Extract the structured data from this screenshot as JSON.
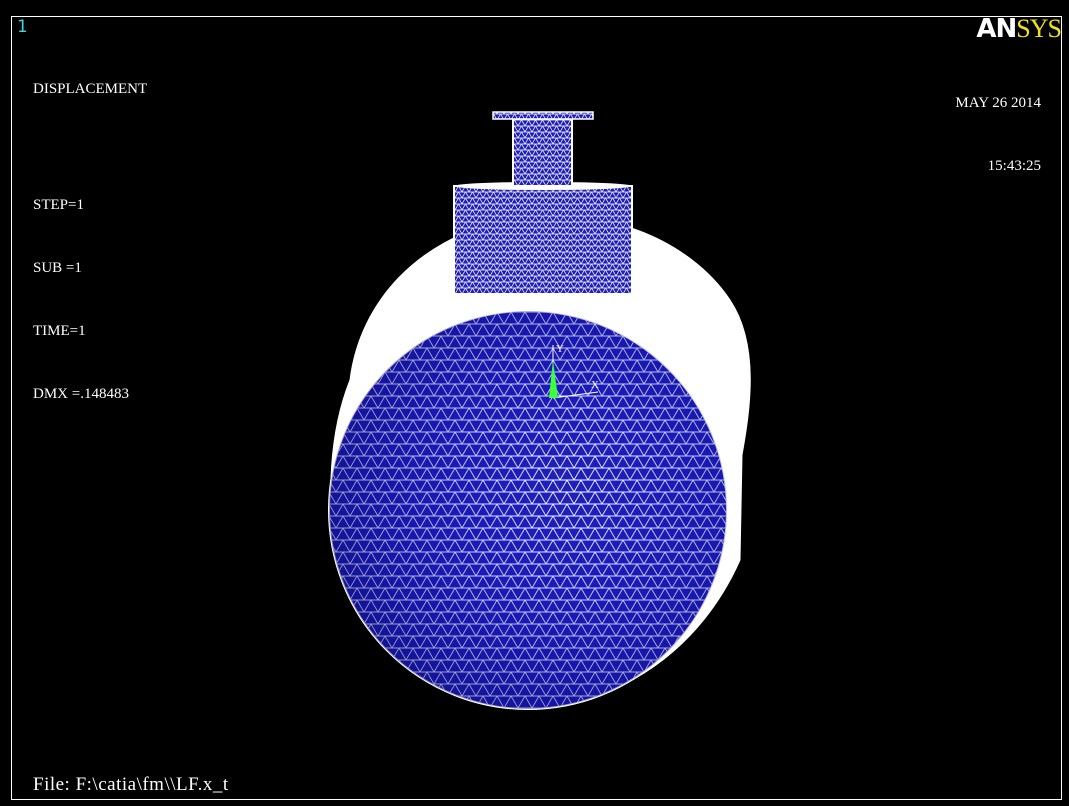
{
  "window_number": "1",
  "logo": {
    "part1": "AN",
    "part2": "SYS"
  },
  "legend": {
    "title": "DISPLACEMENT",
    "step": "STEP=1",
    "sub": "SUB =1",
    "time": "TIME=1",
    "dmx": "DMX =.148483"
  },
  "datetime": {
    "date": "MAY 26 2014",
    "time": "15:43:25"
  },
  "file_label": "File: F:\\catia\\fm\\\\LF.x_t",
  "triad": {
    "x_label": "X",
    "y_label": "Y"
  },
  "colors": {
    "background": "#000000",
    "mesh_fill": "#2020b8",
    "mesh_line": "#ffffff",
    "logo_accent": "#f2e11a",
    "window_number": "#3fd7d7",
    "triad_green": "#3cff3c"
  }
}
